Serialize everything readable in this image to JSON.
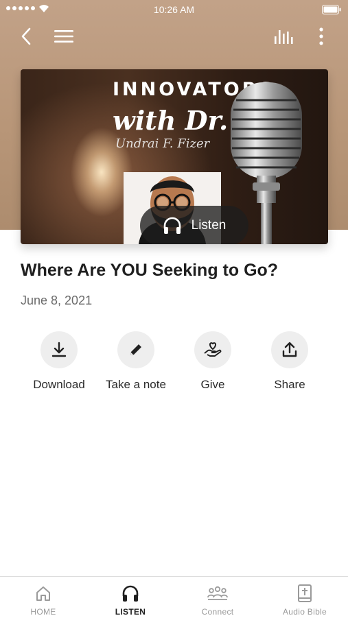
{
  "status_bar": {
    "time": "10:26 AM"
  },
  "artwork": {
    "line1": "INNOVATORS",
    "line2": "with Dr.",
    "line3": "Undrai F. Fizer",
    "listen_label": "Listen"
  },
  "episode": {
    "title": "Where Are YOU Seeking to Go?",
    "date": "June 8, 2021"
  },
  "actions": [
    {
      "label": "Download",
      "icon": "download-icon"
    },
    {
      "label": "Take a note",
      "icon": "pencil-icon"
    },
    {
      "label": "Give",
      "icon": "give-icon"
    },
    {
      "label": "Share",
      "icon": "share-icon"
    }
  ],
  "tabs": [
    {
      "label": "HOME",
      "icon": "home-icon"
    },
    {
      "label": "LISTEN",
      "icon": "headphones-icon"
    },
    {
      "label": "Connect",
      "icon": "people-icon"
    },
    {
      "label": "Audio Bible",
      "icon": "bible-icon"
    }
  ]
}
